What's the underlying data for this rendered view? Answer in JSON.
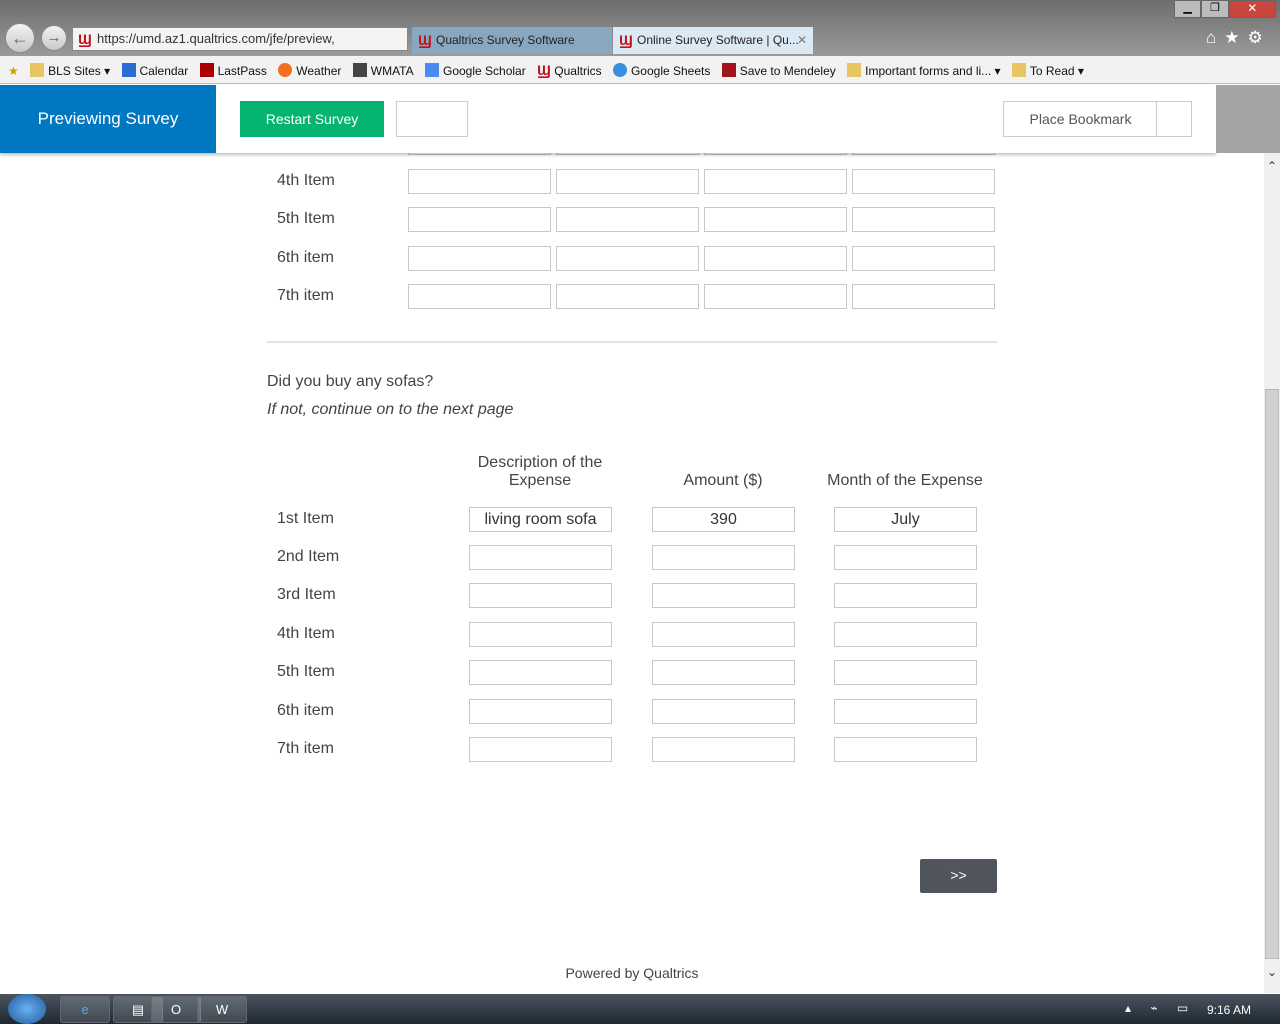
{
  "browser": {
    "url": "https://umd.az1.qualtrics.com/jfe/preview,",
    "tabs": [
      {
        "label": "Qualtrics Survey Software"
      },
      {
        "label": "Online Survey Software | Qu..."
      }
    ],
    "favorites": [
      "BLS Sites",
      "Calendar",
      "LastPass",
      "Weather",
      "WMATA",
      "Google Scholar",
      "Qualtrics",
      "Google Sheets",
      "Save to Mendeley",
      "Important forms and li...",
      "To Read"
    ]
  },
  "header": {
    "title": "Previewing Survey",
    "restart": "Restart Survey",
    "bookmark": "Place Bookmark"
  },
  "table1": {
    "rows": [
      "4th Item",
      "5th Item",
      "6th item",
      "7th item"
    ]
  },
  "question": {
    "text": "Did you buy any sofas?",
    "hint": "If not, continue on to the next page"
  },
  "table2": {
    "columns": [
      "Description of the Expense",
      "Amount ($)",
      "Month of the Expense"
    ],
    "rows": [
      {
        "label": "1st Item",
        "values": [
          "living room sofa",
          "390",
          "July"
        ]
      },
      {
        "label": "2nd Item",
        "values": [
          "",
          "",
          ""
        ]
      },
      {
        "label": "3rd Item",
        "values": [
          "",
          "",
          ""
        ]
      },
      {
        "label": "4th Item",
        "values": [
          "",
          "",
          ""
        ]
      },
      {
        "label": "5th Item",
        "values": [
          "",
          "",
          ""
        ]
      },
      {
        "label": "6th item",
        "values": [
          "",
          "",
          ""
        ]
      },
      {
        "label": "7th item",
        "values": [
          "",
          "",
          ""
        ]
      }
    ]
  },
  "next_label": ">>",
  "footer": "Powered by Qualtrics",
  "taskbar": {
    "time": "9:16 AM"
  },
  "colors": {
    "preview_blue": "#0077c1",
    "restart_green": "#05b471",
    "next_button": "#50555e"
  }
}
